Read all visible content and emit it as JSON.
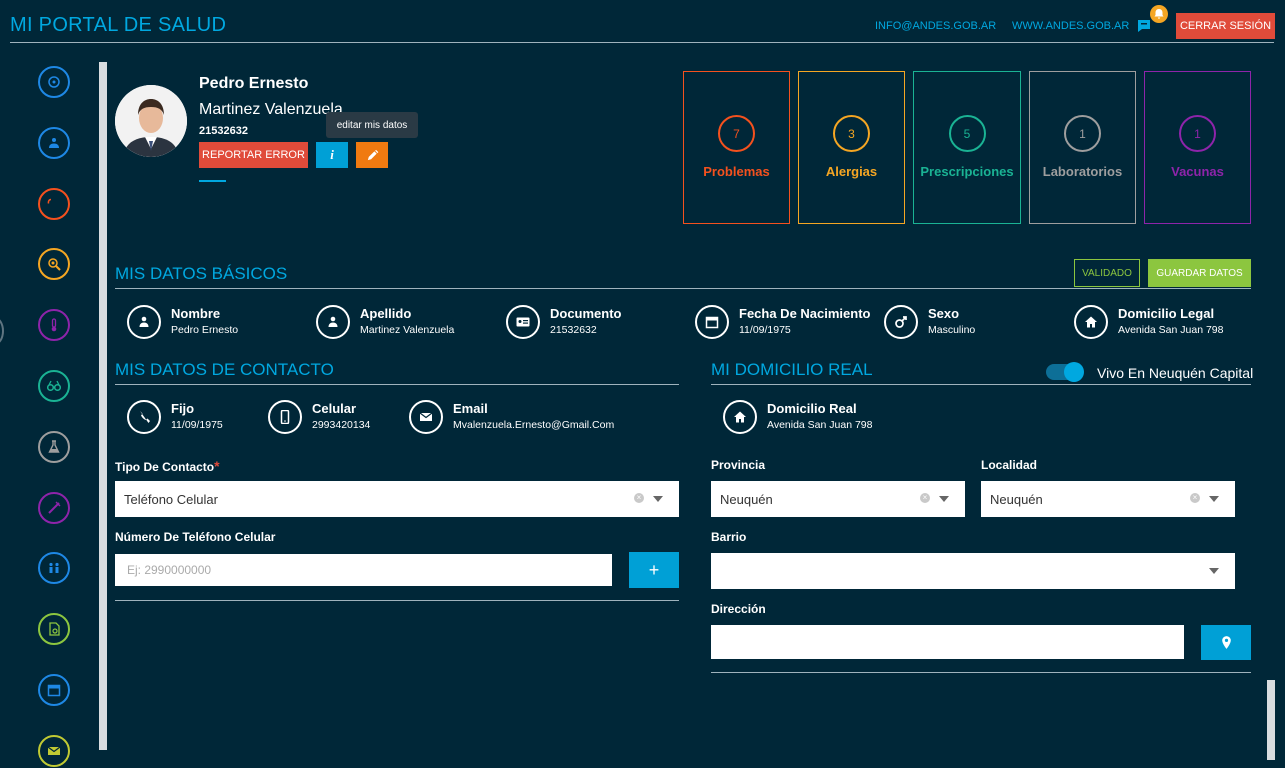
{
  "header": {
    "brand": "MI PORTAL DE SALUD",
    "email_link": "INFO@ANDES.GOB.AR",
    "web_link": "WWW.ANDES.GOB.AR",
    "logout_label": "CERRAR SESIÓN"
  },
  "sidebar": {
    "icons": [
      {
        "name": "home-icon",
        "color": "#1e88e5"
      },
      {
        "name": "patient-icon",
        "color": "#1e88e5"
      },
      {
        "name": "brain-icon",
        "color": "#f4511e"
      },
      {
        "name": "allergy-icon",
        "color": "#f5a623"
      },
      {
        "name": "thermometer-icon",
        "color": "#8e24aa"
      },
      {
        "name": "glasses-icon",
        "color": "#1ab394"
      },
      {
        "name": "flask-icon",
        "color": "#9e9e9e"
      },
      {
        "name": "syringe-icon",
        "color": "#8e24aa"
      },
      {
        "name": "family-icon",
        "color": "#1e88e5"
      },
      {
        "name": "document-search-icon",
        "color": "#8cc63f"
      },
      {
        "name": "calendar-icon",
        "color": "#1e88e5"
      },
      {
        "name": "mail-icon",
        "color": "#c0ca33"
      }
    ]
  },
  "profile": {
    "first_name": "Pedro Ernesto",
    "last_name": "Martinez Valenzuela",
    "document": "21532632",
    "report_error_label": "REPORTAR ERROR",
    "info_label": "i",
    "edit_tooltip": "editar mis datos"
  },
  "stats": [
    {
      "count": "7",
      "label": "Problemas",
      "color": "#f4511e"
    },
    {
      "count": "3",
      "label": "Alergias",
      "color": "#f5a623"
    },
    {
      "count": "5",
      "label": "Prescripciones",
      "color": "#1ab394"
    },
    {
      "count": "1",
      "label": "Laboratorios",
      "color": "#9e9e9e"
    },
    {
      "count": "1",
      "label": "Vacunas",
      "color": "#8e24aa"
    }
  ],
  "basic": {
    "title": "MIS DATOS BÁSICOS",
    "validated_label": "VALIDADO",
    "save_label": "GUARDAR DATOS",
    "items": [
      {
        "key": "Nombre",
        "value": "Pedro Ernesto",
        "icon": "person-icon"
      },
      {
        "key": "Apellido",
        "value": "Martinez Valenzuela",
        "icon": "person-icon"
      },
      {
        "key": "Documento",
        "value": "21532632",
        "icon": "id-card-icon"
      },
      {
        "key": "Fecha De Nacimiento",
        "value": "11/09/1975",
        "icon": "calendar-icon"
      },
      {
        "key": "Sexo",
        "value": "Masculino",
        "icon": "male-icon"
      },
      {
        "key": "Domicilio Legal",
        "value": "Avenida San Juan 798",
        "icon": "house-icon"
      }
    ]
  },
  "contact": {
    "title": "MIS DATOS DE CONTACTO",
    "items": [
      {
        "key": "Fijo",
        "value": "11/09/1975",
        "icon": "phone-icon"
      },
      {
        "key": "Celular",
        "value": "2993420134",
        "icon": "mobile-icon"
      },
      {
        "key": "Email",
        "value": "Mvalenzuela.Ernesto@Gmail.Com",
        "icon": "envelope-icon"
      }
    ],
    "contact_type_label": "Tipo De Contacto",
    "required_mark": "*",
    "contact_type_value": "Teléfono Celular",
    "phone_label": "Número De Teléfono Celular",
    "phone_placeholder": "Ej: 2990000000",
    "add_label": "+"
  },
  "address": {
    "title": "MI DOMICILIO REAL",
    "toggle_label": "Vivo En Neuquén Capital",
    "toggle_on": true,
    "real_key": "Domicilio Real",
    "real_value": "Avenida San Juan 798",
    "province_label": "Provincia",
    "province_value": "Neuquén",
    "locality_label": "Localidad",
    "locality_value": "Neuquén",
    "barrio_label": "Barrio",
    "barrio_value": "",
    "direccion_label": "Dirección",
    "direccion_value": ""
  }
}
